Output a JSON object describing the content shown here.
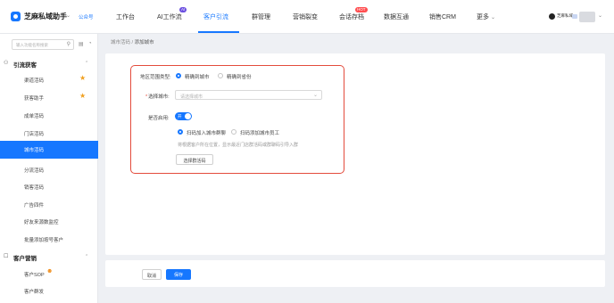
{
  "header": {
    "brand": "芝麻私域助手",
    "official_account": "公众号",
    "nav": [
      {
        "label": "工作台"
      },
      {
        "label": "AI工作流"
      },
      {
        "label": "客户引流"
      },
      {
        "label": "群管理"
      },
      {
        "label": "营销裂变"
      },
      {
        "label": "会话存档"
      },
      {
        "label": "数据互通"
      },
      {
        "label": "销售CRM"
      },
      {
        "label": "更多"
      }
    ],
    "badge_ai": "AI",
    "badge_hot": "HOT",
    "user_name": "芝麻私域"
  },
  "sidebar": {
    "search_placeholder": "输入功能名称搜索",
    "group1": "引流获客",
    "items1": [
      "渠道活码",
      "获客助手",
      "成单活码",
      "门店活码",
      "城市活码",
      "分流活码",
      "销客活码",
      "广告四件",
      "好友来源数监控",
      "批量添加按号客户"
    ],
    "active_index": 4,
    "group2": "客户营销",
    "items2": [
      "客户SOP",
      "客户群发"
    ]
  },
  "breadcrumb": {
    "parent": "城市活码",
    "current": "添加城市"
  },
  "form": {
    "range_label": "地区范围类型:",
    "range_opt1": "精确到城市",
    "range_opt2": "精确到省份",
    "city_label": "选择城市:",
    "city_placeholder": "请选择城市",
    "enable_label": "是否启用:",
    "switch_text": "开",
    "mode_opt1": "扫码加入城市群聊",
    "mode_opt2": "扫码添加城市员工",
    "hint": "将根据客户所在位置，显示最近门店群活码或群聊码引导入群",
    "choose_btn": "选择群活码"
  },
  "footer": {
    "cancel": "取消",
    "save": "保存"
  },
  "colors": {
    "accent": "#1677ff",
    "highlight": "#e34b3c"
  }
}
